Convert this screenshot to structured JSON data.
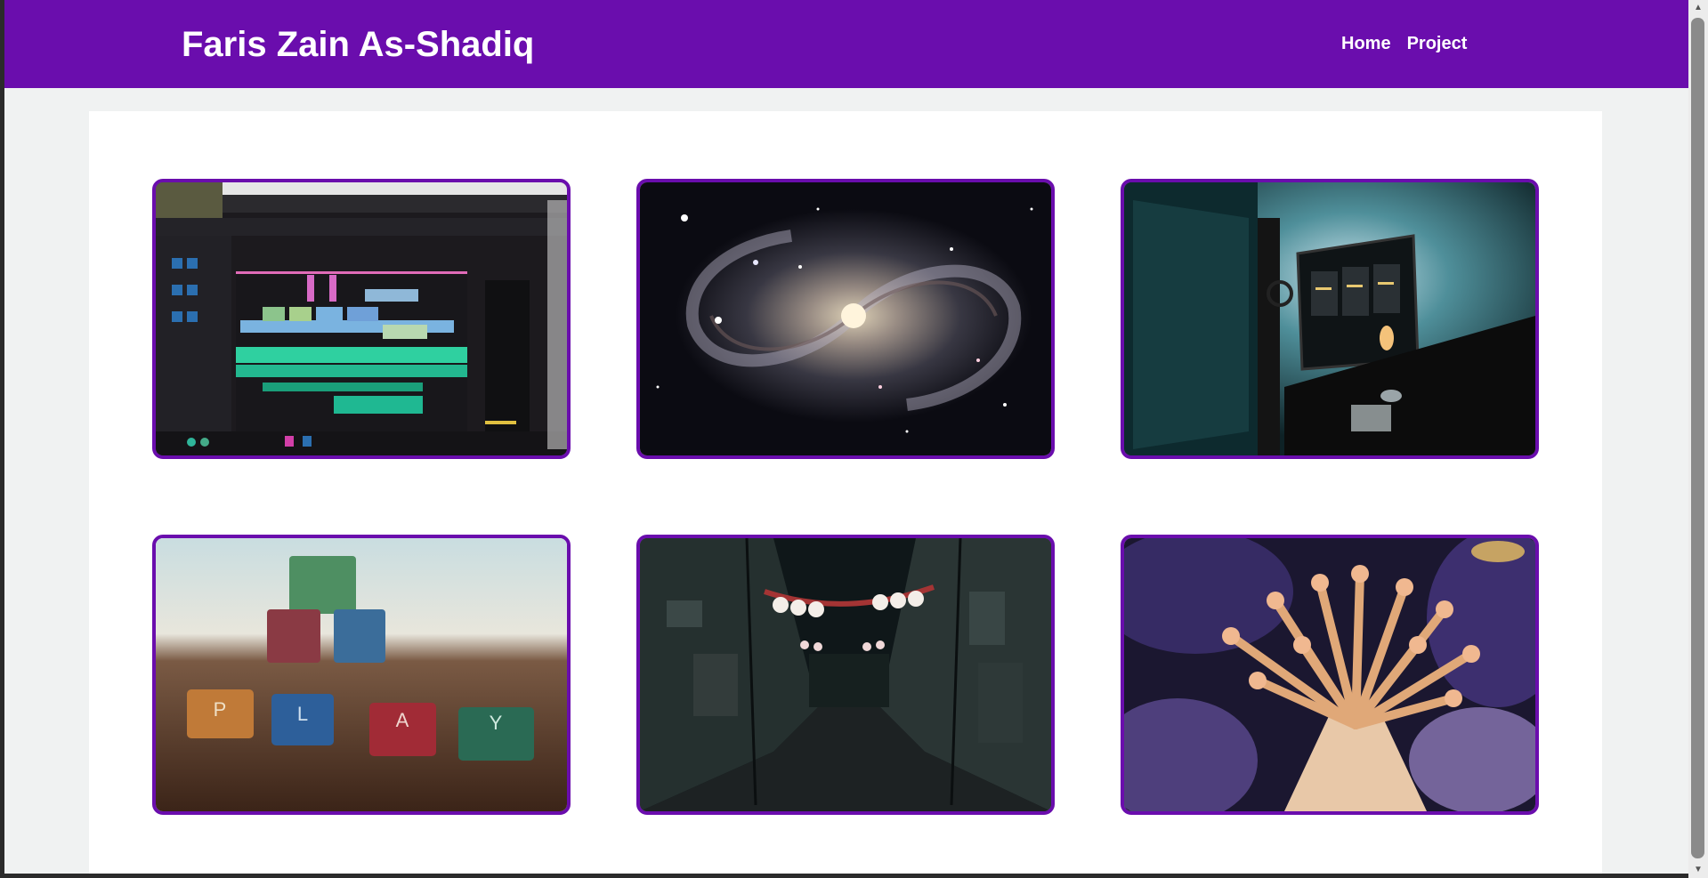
{
  "header": {
    "title": "Faris Zain As-Shadiq",
    "nav": [
      {
        "label": "Home"
      },
      {
        "label": "Project"
      }
    ]
  },
  "gallery": {
    "items": [
      {
        "subject": "video-editing-timeline"
      },
      {
        "subject": "spiral-galaxy"
      },
      {
        "subject": "desk-monitor-setup"
      },
      {
        "subject": "play-letter-blocks",
        "letters": [
          "P",
          "L",
          "A",
          "Y"
        ]
      },
      {
        "subject": "lantern-alley-night"
      },
      {
        "subject": "sea-anemone"
      }
    ]
  },
  "colors": {
    "accent": "#6a0dad",
    "background": "#f0f2f2",
    "panel": "#ffffff"
  }
}
